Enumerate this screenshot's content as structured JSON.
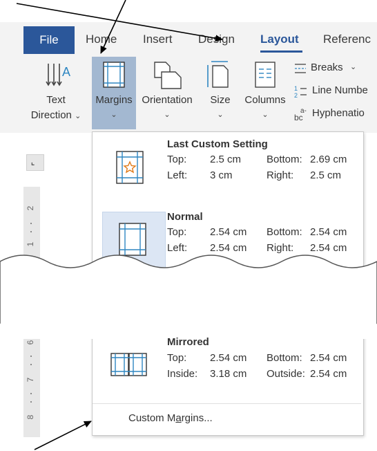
{
  "tabs": {
    "file": "File",
    "home": "Home",
    "insert": "Insert",
    "design": "Design",
    "layout": "Layout",
    "references": "Referenc"
  },
  "ribbon": {
    "text_direction": [
      "Text",
      "Direction"
    ],
    "margins": "Margins",
    "orientation": "Orientation",
    "size": "Size",
    "columns": "Columns",
    "breaks": "Breaks",
    "line_numbers": "Line Numbe",
    "hyphenation": "Hyphenatio"
  },
  "ruler": {
    "numbers": [
      "2",
      "1",
      "6",
      "7",
      "8"
    ]
  },
  "dropdown": {
    "last_custom": {
      "title": "Last Custom Setting",
      "top_label": "Top:",
      "top_value": "2.5 cm",
      "bottom_label": "Bottom:",
      "bottom_value": "2.69 cm",
      "left_label": "Left:",
      "left_value": "3 cm",
      "right_label": "Right:",
      "right_value": "2.5 cm"
    },
    "normal": {
      "title": "Normal",
      "top_label": "Top:",
      "top_value": "2.54 cm",
      "bottom_label": "Bottom:",
      "bottom_value": "2.54 cm",
      "left_label": "Left:",
      "left_value": "2.54 cm",
      "right_label": "Right:",
      "right_value": "2.54 cm"
    },
    "mirrored": {
      "title": "Mirrored",
      "top_label": "Top:",
      "top_value": "2.54 cm",
      "bottom_label": "Bottom:",
      "bottom_value": "2.54 cm",
      "inside_label": "Inside:",
      "inside_value": "3.18 cm",
      "outside_label": "Outside:",
      "outside_value": "2.54 cm"
    },
    "custom_margins": {
      "before": "Custom M",
      "underlined": "a",
      "after": "rgins..."
    }
  },
  "colors": {
    "accent": "#2b579a",
    "selected_button": "#a3b8d1",
    "selected_item": "#dce6f4",
    "icon_blue": "#2e86c1",
    "star_orange": "#e07b1a"
  }
}
